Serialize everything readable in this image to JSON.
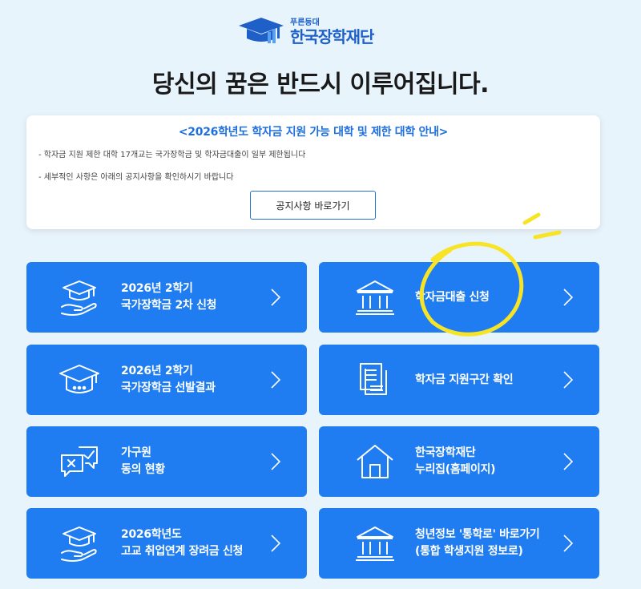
{
  "logo": {
    "sub": "푸른등대",
    "name": "한국장학재단"
  },
  "headline": "당신의 꿈은 반드시 이루어집니다.",
  "notice": {
    "title": "<2026학년도 학자금 지원 가능 대학 및 제한 대학 안내>",
    "line1": "- 학자금 지원 제한 대학 17개교는 국가장학금 및 학자금대출이 일부 제한됩니다",
    "line2": "- 세부적인 사항은 아래의 공지사항을 확인하시기 바랍니다",
    "button": "공지사항 바로가기"
  },
  "cards": [
    {
      "line1": "2026년 2학기",
      "line2": "국가장학금 2차 신청",
      "icon": "graduation-cap-hand-icon"
    },
    {
      "line1": "학자금대출 신청",
      "line2": "",
      "icon": "bank-building-icon"
    },
    {
      "line1": "2026년 2학기",
      "line2": "국가장학금 선발결과",
      "icon": "graduation-cap-icon"
    },
    {
      "line1": "학자금 지원구간 확인",
      "line2": "",
      "icon": "document-stack-icon"
    },
    {
      "line1": "가구원",
      "line2": "동의 현황",
      "icon": "consent-chat-icon"
    },
    {
      "line1": "한국장학재단",
      "line2": "누리집(홈페이지)",
      "icon": "house-icon"
    },
    {
      "line1": "2026학년도",
      "line2": "고교 취업연계 장려금 신청",
      "icon": "graduation-cap-hand-icon"
    },
    {
      "line1": "청년정보 '통학로' 바로가기",
      "line2": "(통합 학생지원 정보로)",
      "icon": "bank-building-icon"
    }
  ],
  "colors": {
    "card": "#1f7df1",
    "accent": "#1e6fe0",
    "background": "#e8f4fb",
    "highlight": "#f7e427"
  }
}
